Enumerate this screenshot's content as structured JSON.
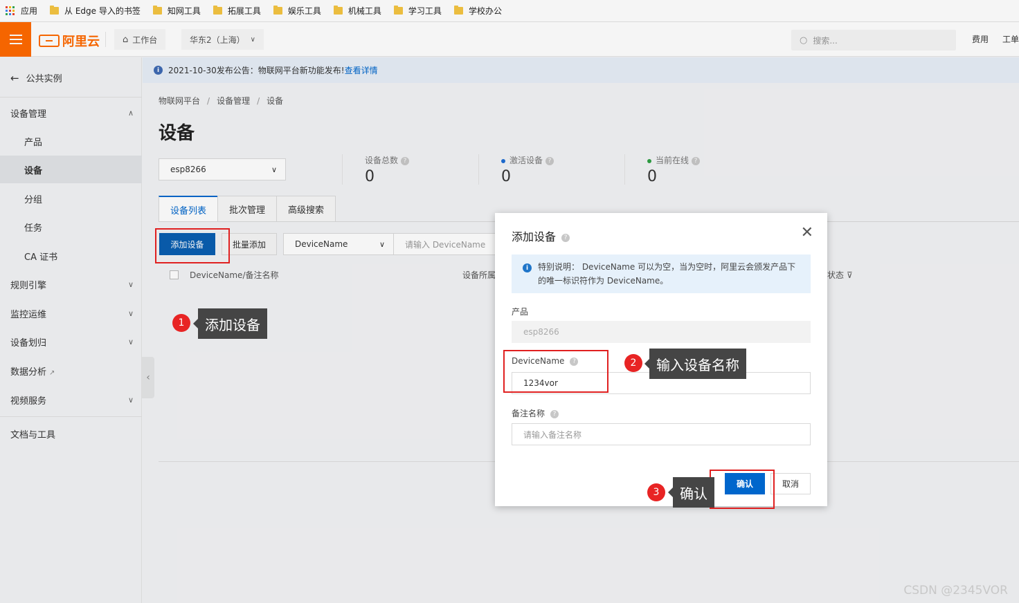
{
  "bookmarks": [
    {
      "label": "应用",
      "type": "apps"
    },
    {
      "label": "从 Edge 导入的书签",
      "type": "folder"
    },
    {
      "label": "知网工具",
      "type": "folder"
    },
    {
      "label": "拓展工具",
      "type": "folder"
    },
    {
      "label": "娱乐工具",
      "type": "folder"
    },
    {
      "label": "机械工具",
      "type": "folder"
    },
    {
      "label": "学习工具",
      "type": "folder"
    },
    {
      "label": "学校办公",
      "type": "folder"
    }
  ],
  "topbar": {
    "brand": "阿里云",
    "workbench": "工作台",
    "region": "华东2（上海）",
    "search_placeholder": "搜索...",
    "links": [
      "费用",
      "工单"
    ],
    "brand_color": "#ff6a00"
  },
  "sidebar": {
    "back_label": "公共实例",
    "groups": [
      {
        "label": "设备管理",
        "expanded": true,
        "items": [
          "产品",
          "设备",
          "分组",
          "任务",
          "CA 证书"
        ],
        "active_item": "设备"
      },
      {
        "label": "规则引擎",
        "expanded": false
      },
      {
        "label": "监控运维",
        "expanded": false
      },
      {
        "label": "设备划归",
        "expanded": false
      },
      {
        "label": "数据分析",
        "expanded": false
      },
      {
        "label": "视频服务",
        "expanded": false
      },
      {
        "label": "文档与工具",
        "expanded": false
      }
    ]
  },
  "notice": {
    "text": "2021-10-30发布公告：物联网平台新功能发布!",
    "link": "查看详情"
  },
  "breadcrumb": [
    "物联网平台",
    "设备管理",
    "设备"
  ],
  "page_title": "设备",
  "product_select": "esp8266",
  "stats": [
    {
      "label": "设备总数",
      "value": "0"
    },
    {
      "label": "激活设备",
      "value": "0",
      "dot_color": "#1f6ed4"
    },
    {
      "label": "当前在线",
      "value": "0",
      "dot_color": "#2ea043"
    }
  ],
  "tabs": [
    "设备列表",
    "批次管理",
    "高级搜索"
  ],
  "toolbar": {
    "add_device": "添加设备",
    "batch_add": "批量添加",
    "filter_field": "DeviceName",
    "filter_placeholder": "请输入 DeviceName"
  },
  "table": {
    "col1": "DeviceName/备注名称",
    "col2": "设备所属",
    "col3": "状态"
  },
  "dialog": {
    "title": "添加设备",
    "info": "特别说明： DeviceName 可以为空，当为空时，阿里云会颁发产品下的唯一标识符作为 DeviceName。",
    "product_label": "产品",
    "product_value": "esp8266",
    "devicename_label": "DeviceName",
    "devicename_value": "1234vor",
    "remark_label": "备注名称",
    "remark_placeholder": "请输入备注名称",
    "ok": "确认",
    "cancel": "取消"
  },
  "annotations": [
    {
      "num": "1",
      "text": "添加设备"
    },
    {
      "num": "2",
      "text": "输入设备名称"
    },
    {
      "num": "3",
      "text": "确认"
    }
  ],
  "watermark": "CSDN @2345VOR"
}
